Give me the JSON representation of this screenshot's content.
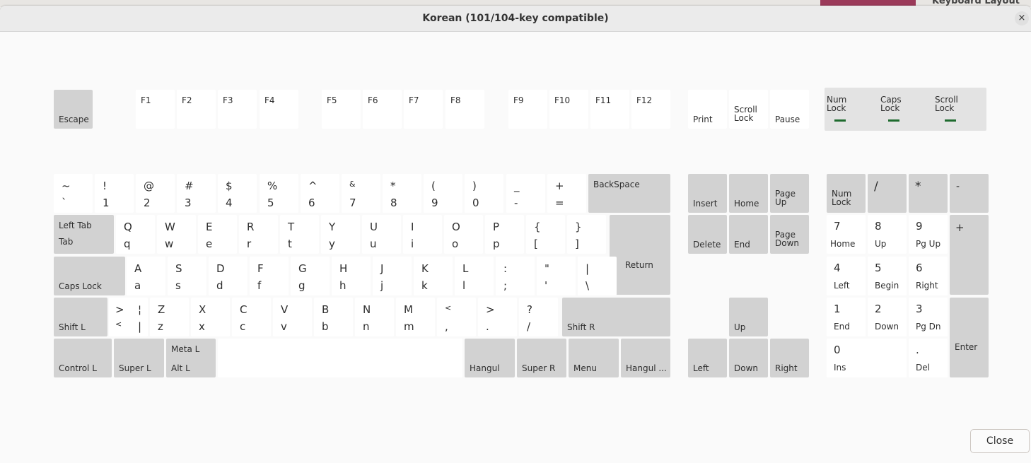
{
  "background": {
    "partial_title": "Keyboard Layout"
  },
  "window": {
    "title": "Korean (101/104-key compatible)",
    "close_icon": "×",
    "close_button": "Close"
  },
  "keys": {
    "esc": {
      "label": "Escape"
    },
    "f1": {
      "label": "F1"
    },
    "f2": {
      "label": "F2"
    },
    "f3": {
      "label": "F3"
    },
    "f4": {
      "label": "F4"
    },
    "f5": {
      "label": "F5"
    },
    "f6": {
      "label": "F6"
    },
    "f7": {
      "label": "F7"
    },
    "f8": {
      "label": "F8"
    },
    "f9": {
      "label": "F9"
    },
    "f10": {
      "label": "F10"
    },
    "f11": {
      "label": "F11"
    },
    "f12": {
      "label": "F12"
    },
    "print": {
      "label": "Print"
    },
    "scroll": {
      "line1": "Scroll",
      "line2": "Lock"
    },
    "pause": {
      "label": "Pause"
    },
    "indicators": {
      "num": {
        "line1": "Num",
        "line2": "Lock"
      },
      "caps": {
        "line1": "Caps",
        "line2": "Lock"
      },
      "scroll": {
        "line1": "Scroll",
        "line2": "Lock"
      },
      "led_color": "#1e6b2e"
    },
    "grave": {
      "top": "~",
      "bottom": "`"
    },
    "d1": {
      "top": "!",
      "bottom": "1"
    },
    "d2": {
      "top": "@",
      "bottom": "2"
    },
    "d3": {
      "top": "#",
      "bottom": "3"
    },
    "d4": {
      "top": "$",
      "bottom": "4"
    },
    "d5": {
      "top": "%",
      "bottom": "5"
    },
    "d6": {
      "top": "^",
      "bottom": "6"
    },
    "d7": {
      "top": "&",
      "bottom": "7"
    },
    "d8": {
      "top": "*",
      "bottom": "8"
    },
    "d9": {
      "top": "(",
      "bottom": "9"
    },
    "d0": {
      "top": ")",
      "bottom": "0"
    },
    "minus": {
      "top": "_",
      "bottom": "-"
    },
    "equal": {
      "top": "+",
      "bottom": "="
    },
    "backspace": {
      "label": "BackSpace"
    },
    "tab": {
      "top": "Left Tab",
      "bottom": "Tab"
    },
    "q": {
      "top": "Q",
      "bottom": "q"
    },
    "w": {
      "top": "W",
      "bottom": "w"
    },
    "e": {
      "top": "E",
      "bottom": "e"
    },
    "r": {
      "top": "R",
      "bottom": "r"
    },
    "t": {
      "top": "T",
      "bottom": "t"
    },
    "y": {
      "top": "Y",
      "bottom": "y"
    },
    "u": {
      "top": "U",
      "bottom": "u"
    },
    "i": {
      "top": "I",
      "bottom": "i"
    },
    "o": {
      "top": "O",
      "bottom": "o"
    },
    "p": {
      "top": "P",
      "bottom": "p"
    },
    "lbracket": {
      "top": "{",
      "bottom": "["
    },
    "rbracket": {
      "top": "}",
      "bottom": "]"
    },
    "return": {
      "label": "Return"
    },
    "caps": {
      "label": "Caps Lock"
    },
    "a": {
      "top": "A",
      "bottom": "a"
    },
    "s": {
      "top": "S",
      "bottom": "s"
    },
    "d": {
      "top": "D",
      "bottom": "d"
    },
    "f": {
      "top": "F",
      "bottom": "f"
    },
    "g": {
      "top": "G",
      "bottom": "g"
    },
    "h": {
      "top": "H",
      "bottom": "h"
    },
    "j": {
      "top": "J",
      "bottom": "j"
    },
    "k": {
      "top": "K",
      "bottom": "k"
    },
    "l": {
      "top": "L",
      "bottom": "l"
    },
    "semicolon": {
      "top": ":",
      "bottom": ";"
    },
    "quote": {
      "top": "\"",
      "bottom": "'"
    },
    "backslash": {
      "top": "|",
      "bottom": "\\"
    },
    "lshift": {
      "label": "Shift L"
    },
    "lsgt": {
      "tl": ">",
      "bl": "<",
      "tr": "¦",
      "br": "|"
    },
    "z": {
      "top": "Z",
      "bottom": "z"
    },
    "x": {
      "top": "X",
      "bottom": "x"
    },
    "c": {
      "top": "C",
      "bottom": "c"
    },
    "v": {
      "top": "V",
      "bottom": "v"
    },
    "b": {
      "top": "B",
      "bottom": "b"
    },
    "n": {
      "top": "N",
      "bottom": "n"
    },
    "m": {
      "top": "M",
      "bottom": "m"
    },
    "comma": {
      "top": "<",
      "bottom": ","
    },
    "period": {
      "top": ">",
      "bottom": "."
    },
    "slash": {
      "top": "?",
      "bottom": "/"
    },
    "rshift": {
      "label": "Shift R"
    },
    "lctrl": {
      "label": "Control L"
    },
    "lsuper": {
      "label": "Super L"
    },
    "lalt": {
      "top": "Meta L",
      "bottom": "Alt L"
    },
    "hangul": {
      "label": "Hangul"
    },
    "rsuper": {
      "label": "Super R"
    },
    "menu": {
      "label": "Menu"
    },
    "hanja": {
      "label": "Hangul ..."
    },
    "insert": {
      "label": "Insert"
    },
    "home": {
      "label": "Home"
    },
    "pgup": {
      "line1": "Page",
      "line2": "Up"
    },
    "delete": {
      "label": "Delete"
    },
    "end": {
      "label": "End"
    },
    "pgdn": {
      "line1": "Page",
      "line2": "Down"
    },
    "up": {
      "label": "Up"
    },
    "left": {
      "label": "Left"
    },
    "down": {
      "label": "Down"
    },
    "right": {
      "label": "Right"
    },
    "numlock": {
      "line1": "Num",
      "line2": "Lock"
    },
    "kpdiv": {
      "label": "/"
    },
    "kpmul": {
      "label": "*"
    },
    "kpsub": {
      "label": "-"
    },
    "kpadd": {
      "label": "+"
    },
    "kp7": {
      "top": "7",
      "bottom": "Home"
    },
    "kp8": {
      "top": "8",
      "bottom": "Up"
    },
    "kp9": {
      "top": "9",
      "bottom": "Pg Up"
    },
    "kp4": {
      "top": "4",
      "bottom": "Left"
    },
    "kp5": {
      "top": "5",
      "bottom": "Begin"
    },
    "kp6": {
      "top": "6",
      "bottom": "Right"
    },
    "kp1": {
      "top": "1",
      "bottom": "End"
    },
    "kp2": {
      "top": "2",
      "bottom": "Down"
    },
    "kp3": {
      "top": "3",
      "bottom": "Pg Dn"
    },
    "kp0": {
      "top": "0",
      "bottom": "Ins"
    },
    "kpdec": {
      "top": ".",
      "bottom": "Del"
    },
    "kpenter": {
      "label": "Enter"
    }
  }
}
